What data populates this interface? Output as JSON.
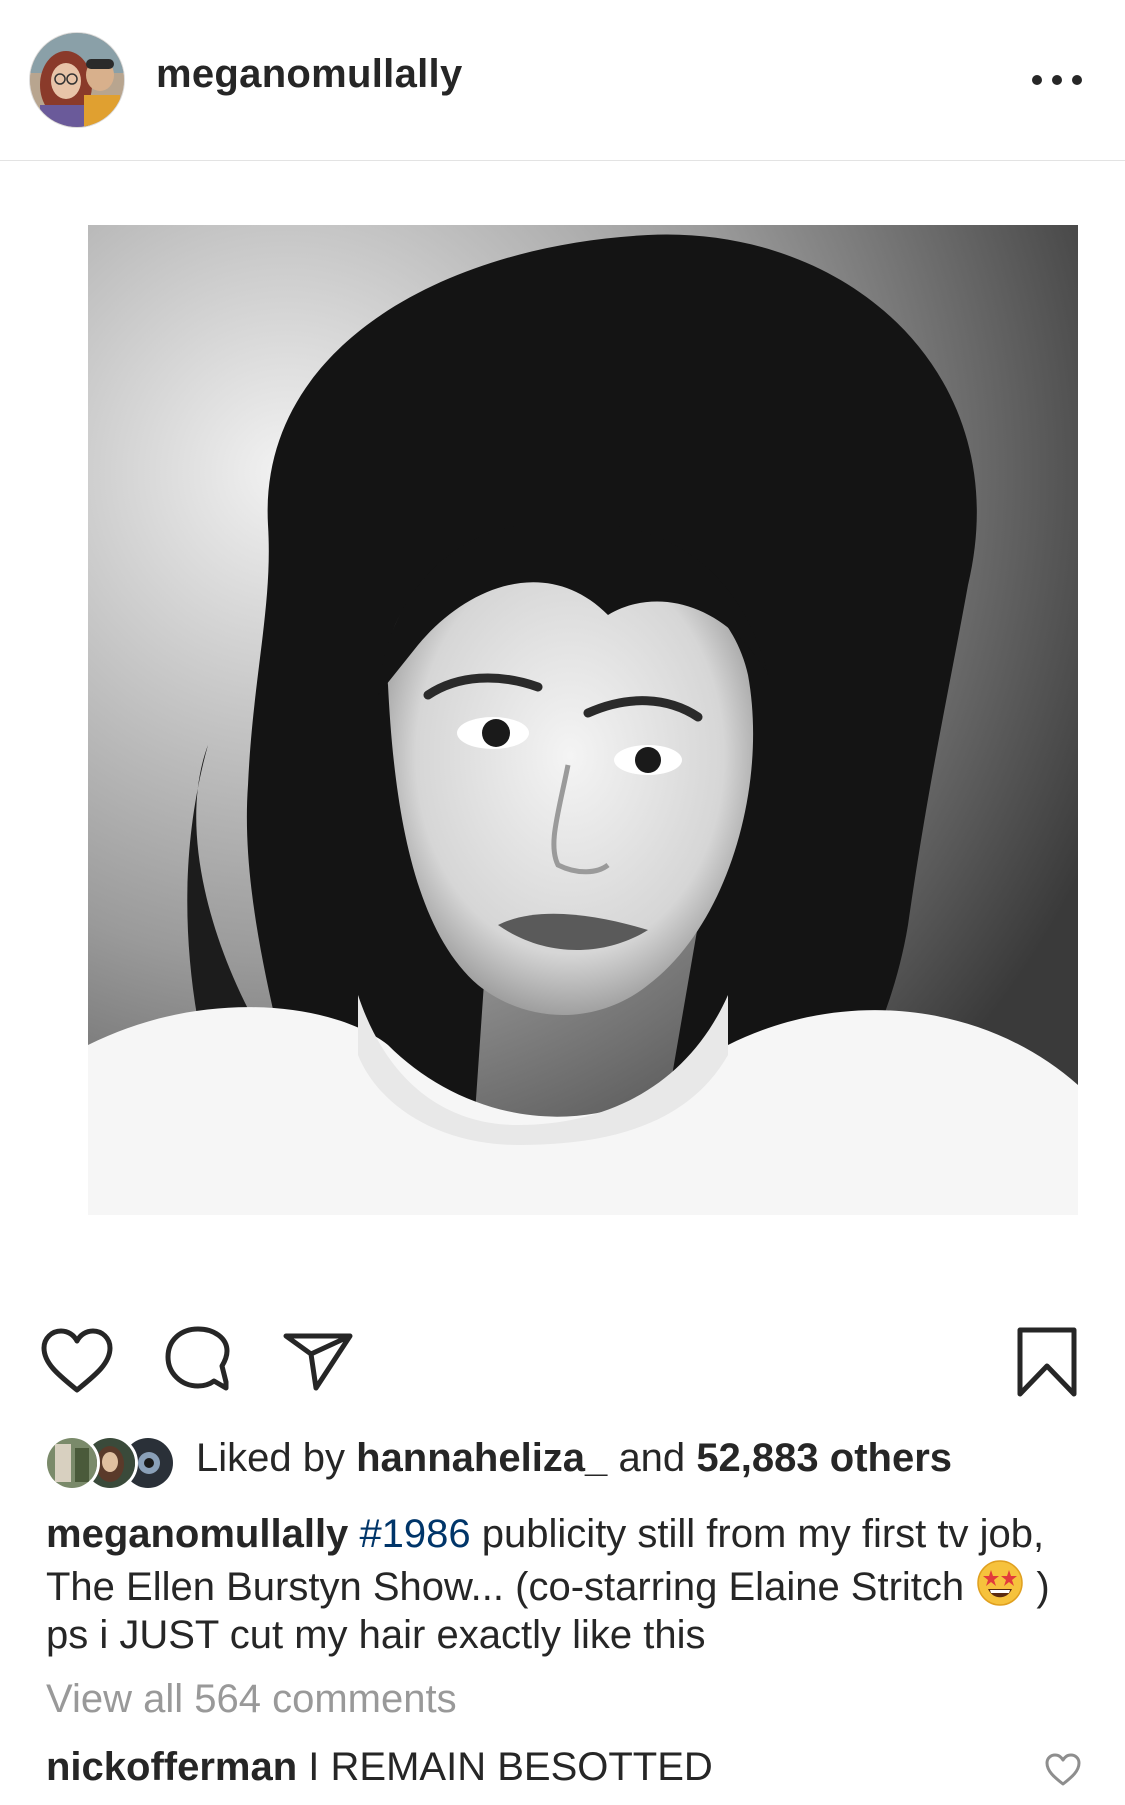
{
  "post": {
    "username": "meganomullally",
    "more_icon": "more-horizontal-icon",
    "photo_alt": "meganomullally post photo"
  },
  "actions": {
    "like_icon": "heart-icon",
    "comment_icon": "comment-icon",
    "share_icon": "direct-share-icon",
    "save_icon": "bookmark-icon"
  },
  "likes": {
    "prefix": "Liked by",
    "first_liker": "hannaheliza_",
    "joiner": "and",
    "others": "52,883 others"
  },
  "caption": {
    "username": "meganomullally",
    "hashtag": "#1986",
    "text_before_emoji": "publicity still from my first tv job, The Ellen Burstyn Show... (co-starring Elaine Stritch",
    "emoji": "star-struck-emoji",
    "text_after_emoji": ") ps i JUST cut my hair exactly like this"
  },
  "comments": {
    "view_all": "View all 564 comments",
    "items": [
      {
        "username": "nickofferman",
        "text": "I REMAIN BESOTTED"
      }
    ]
  },
  "colors": {
    "text": "#262626",
    "link": "#003569",
    "muted": "#999999",
    "divider": "#e3e3e3"
  }
}
